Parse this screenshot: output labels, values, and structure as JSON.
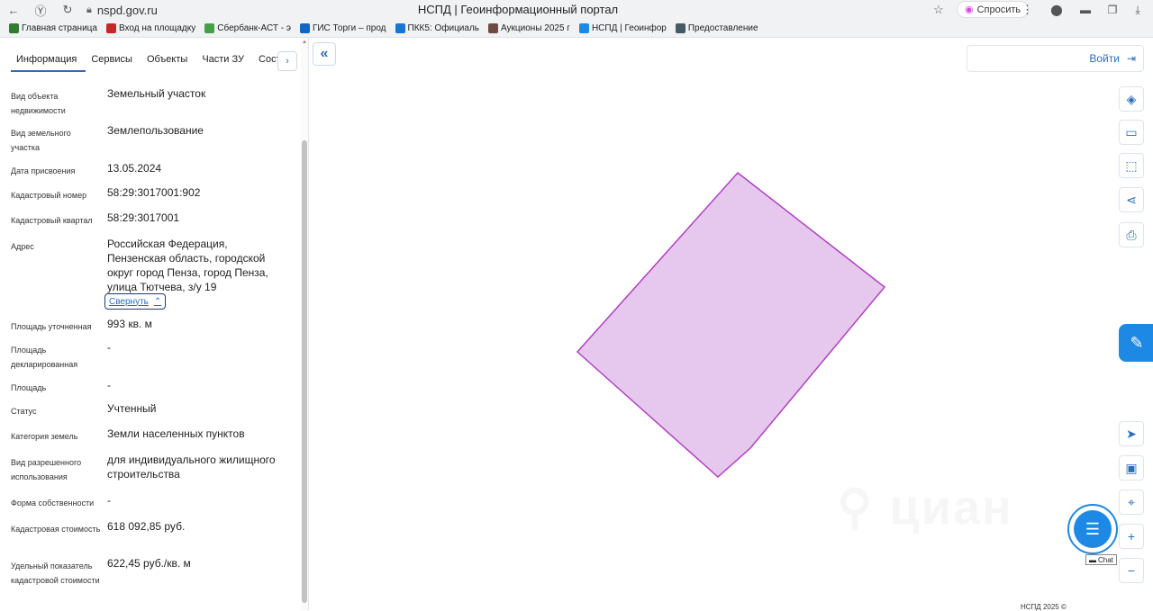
{
  "browser": {
    "url": "nspd.gov.ru",
    "title": "НСПД | Геоинформационный портал",
    "ask_label": "Спросить",
    "bookmarks": [
      {
        "label": "Главная страница",
        "color": "#2e7d32"
      },
      {
        "label": "Вход на площадку",
        "color": "#c62828"
      },
      {
        "label": "Сбербанк-АСТ - э",
        "color": "#43a047"
      },
      {
        "label": "ГИС Торги – прод",
        "color": "#1565c0"
      },
      {
        "label": "ПКК5: Официаль",
        "color": "#1976d2"
      },
      {
        "label": "Аукционы 2025 г",
        "color": "#6d4c41"
      },
      {
        "label": "НСПД | Геоинфор",
        "color": "#1e88e5"
      },
      {
        "label": "Предоставление",
        "color": "#455a64"
      }
    ]
  },
  "panel": {
    "tabs": [
      "Информация",
      "Сервисы",
      "Объекты",
      "Части ЗУ",
      "Соста"
    ],
    "active_tab": 0,
    "fields": [
      {
        "label": "Вид объекта недвижимости",
        "value": "Земельный участок"
      },
      {
        "label": "Вид земельного участка",
        "value": "Землепользование"
      },
      {
        "label": "Дата присвоения",
        "value": "13.05.2024"
      },
      {
        "label": "Кадастровый номер",
        "value": "58:29:3017001:902"
      },
      {
        "label": "Кадастровый квартал",
        "value": "58:29:3017001"
      },
      {
        "label": "Адрес",
        "value": "Российская Федерация, Пензенская область, городской округ город Пенза, город Пенза, улица Тютчева, з/у 19"
      },
      {
        "label": "Площадь уточненная",
        "value": "993 кв. м"
      },
      {
        "label": "Площадь декларированная",
        "value": "-"
      },
      {
        "label": "Площадь",
        "value": "-"
      },
      {
        "label": "Статус",
        "value": "Учтенный"
      },
      {
        "label": "Категория земель",
        "value": "Земли населенных пунктов"
      },
      {
        "label": "Вид разрешенного использования",
        "value": "для индивидуального жилищного строительства"
      },
      {
        "label": "Форма собственности",
        "value": "-"
      },
      {
        "label": "Кадастровая стоимость",
        "value": "618 092,85 руб."
      },
      {
        "label": "Удельный показатель кадастровой стоимости",
        "value": "622,45 руб./кв. м"
      }
    ],
    "collapse_label": "Свернуть"
  },
  "map": {
    "login_label": "Войти",
    "parcel_fill": "#e6c8ee",
    "parcel_stroke": "#b040c0",
    "accent": "#1e88e5",
    "tools": [
      "layers-icon",
      "ruler-icon",
      "select-area-icon",
      "share-icon",
      "print-icon",
      "locate-icon",
      "minimap-icon",
      "pin-icon",
      "zoom-in-icon",
      "zoom-out-icon"
    ],
    "chat_tag": "Chat",
    "footer": "НСПД 2025 ©"
  }
}
